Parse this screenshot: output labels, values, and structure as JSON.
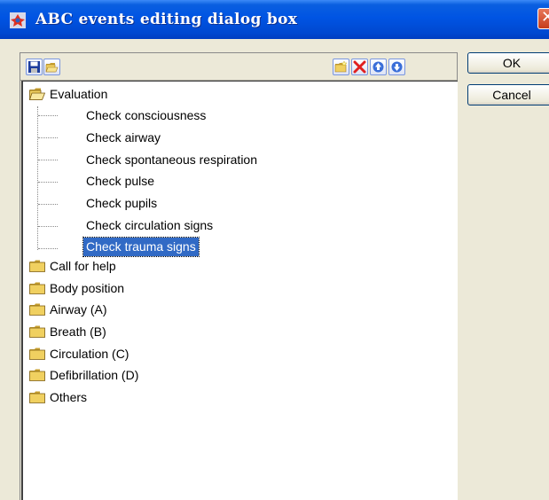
{
  "window": {
    "title": "ABC events editing dialog box"
  },
  "buttons": {
    "ok": "OK",
    "cancel": "Cancel"
  },
  "tree": {
    "nodes": [
      {
        "label": "Evaluation",
        "expanded": true,
        "children": [
          "Check consciousness",
          "Check airway",
          "Check spontaneous respiration",
          "Check pulse",
          "Check pupils",
          "Check circulation signs",
          "Check trauma signs"
        ]
      },
      {
        "label": "Call for help"
      },
      {
        "label": "Body position"
      },
      {
        "label": "Airway (A)"
      },
      {
        "label": "Breath (B)"
      },
      {
        "label": "Circulation (C)"
      },
      {
        "label": "Defibrillation (D)"
      },
      {
        "label": "Others"
      }
    ],
    "selected": "Check trauma signs"
  },
  "icons": {
    "toolbar_left": [
      "save-icon",
      "open-folder-icon"
    ],
    "toolbar_right": [
      "new-folder-icon",
      "delete-icon",
      "move-up-icon",
      "move-down-icon"
    ]
  },
  "colors": {
    "title_bar": "#0054e3",
    "selection": "#316ac5",
    "folder": "#f0d060",
    "delete": "#e02020"
  }
}
